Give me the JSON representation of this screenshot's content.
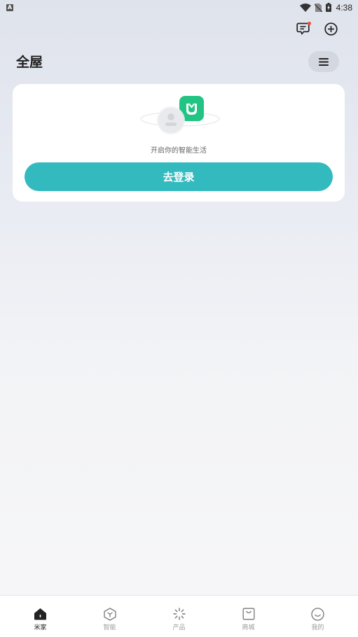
{
  "status_bar": {
    "left_badge": "A",
    "time": "4:38",
    "icons": [
      "wifi-icon",
      "no-sim-icon",
      "battery-charging-icon"
    ]
  },
  "header": {
    "title": "全屋",
    "actions": [
      "message-icon",
      "add-icon"
    ],
    "menu_icon": "menu-icon"
  },
  "login_card": {
    "caption": "开启你的智能生活",
    "button_label": "去登录",
    "accent_color": "#33babf",
    "logo_color": "#22c483"
  },
  "tab_bar": {
    "items": [
      {
        "label": "米家",
        "icon": "home-icon",
        "active": true
      },
      {
        "label": "智能",
        "icon": "smart-icon",
        "active": false
      },
      {
        "label": "产品",
        "icon": "product-icon",
        "active": false
      },
      {
        "label": "商城",
        "icon": "store-icon",
        "active": false
      },
      {
        "label": "我的",
        "icon": "profile-icon",
        "active": false
      }
    ]
  }
}
